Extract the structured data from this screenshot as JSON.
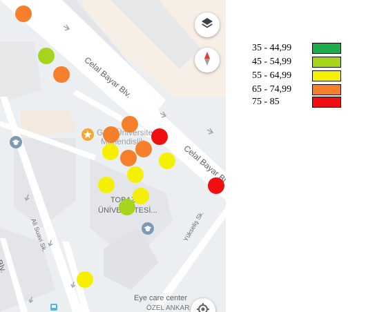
{
  "map": {
    "streets": {
      "celal_bayar_1": "Celal Bayar Blv.",
      "celal_bayar_2": "Celal Bayar Bl",
      "blv_left": "Blv.",
      "ali_suavi": "Ali Suavi Sk.",
      "yukselis": "Yükseliş Sk."
    },
    "poi": {
      "university_line1": "Gazi Üniversitesi",
      "university_line2": "Mühendislik",
      "campus_line1": "TOBAZİ",
      "campus_line2": "ÜNİVERSİTESİ...",
      "eye_care_line1": "Eye care center",
      "eye_care_line2": "ÖZEL ANKAR"
    },
    "controls": {
      "layers_icon": "layers-icon",
      "compass_icon": "compass-icon",
      "location_icon": "my-location-icon"
    },
    "measurements": [
      {
        "category": "65 - 74,99"
      },
      {
        "category": "45 - 54,99"
      },
      {
        "category": "65 - 74,99"
      },
      {
        "category": "65 - 74,99"
      },
      {
        "category": "65 - 74,99"
      },
      {
        "category": "75 - 85"
      },
      {
        "category": "65 - 74,99"
      },
      {
        "category": "55 - 64,99"
      },
      {
        "category": "65 - 74,99"
      },
      {
        "category": "55 - 64,99"
      },
      {
        "category": "55 - 64,99"
      },
      {
        "category": "55 - 64,99"
      },
      {
        "category": "55 - 64,99"
      },
      {
        "category": "45 - 54,99"
      },
      {
        "category": "75 - 85"
      },
      {
        "category": "55 - 64,99"
      }
    ]
  },
  "legend": {
    "items": [
      {
        "label": "35 - 44,99",
        "color": "#1eab4c"
      },
      {
        "label": "45 - 54,99",
        "color": "#a6d41c"
      },
      {
        "label": "55 - 64,99",
        "color": "#f5f000"
      },
      {
        "label": "65 - 74,99",
        "color": "#f57f2a"
      },
      {
        "label": "75 - 85",
        "color": "#ef0f12"
      }
    ]
  }
}
